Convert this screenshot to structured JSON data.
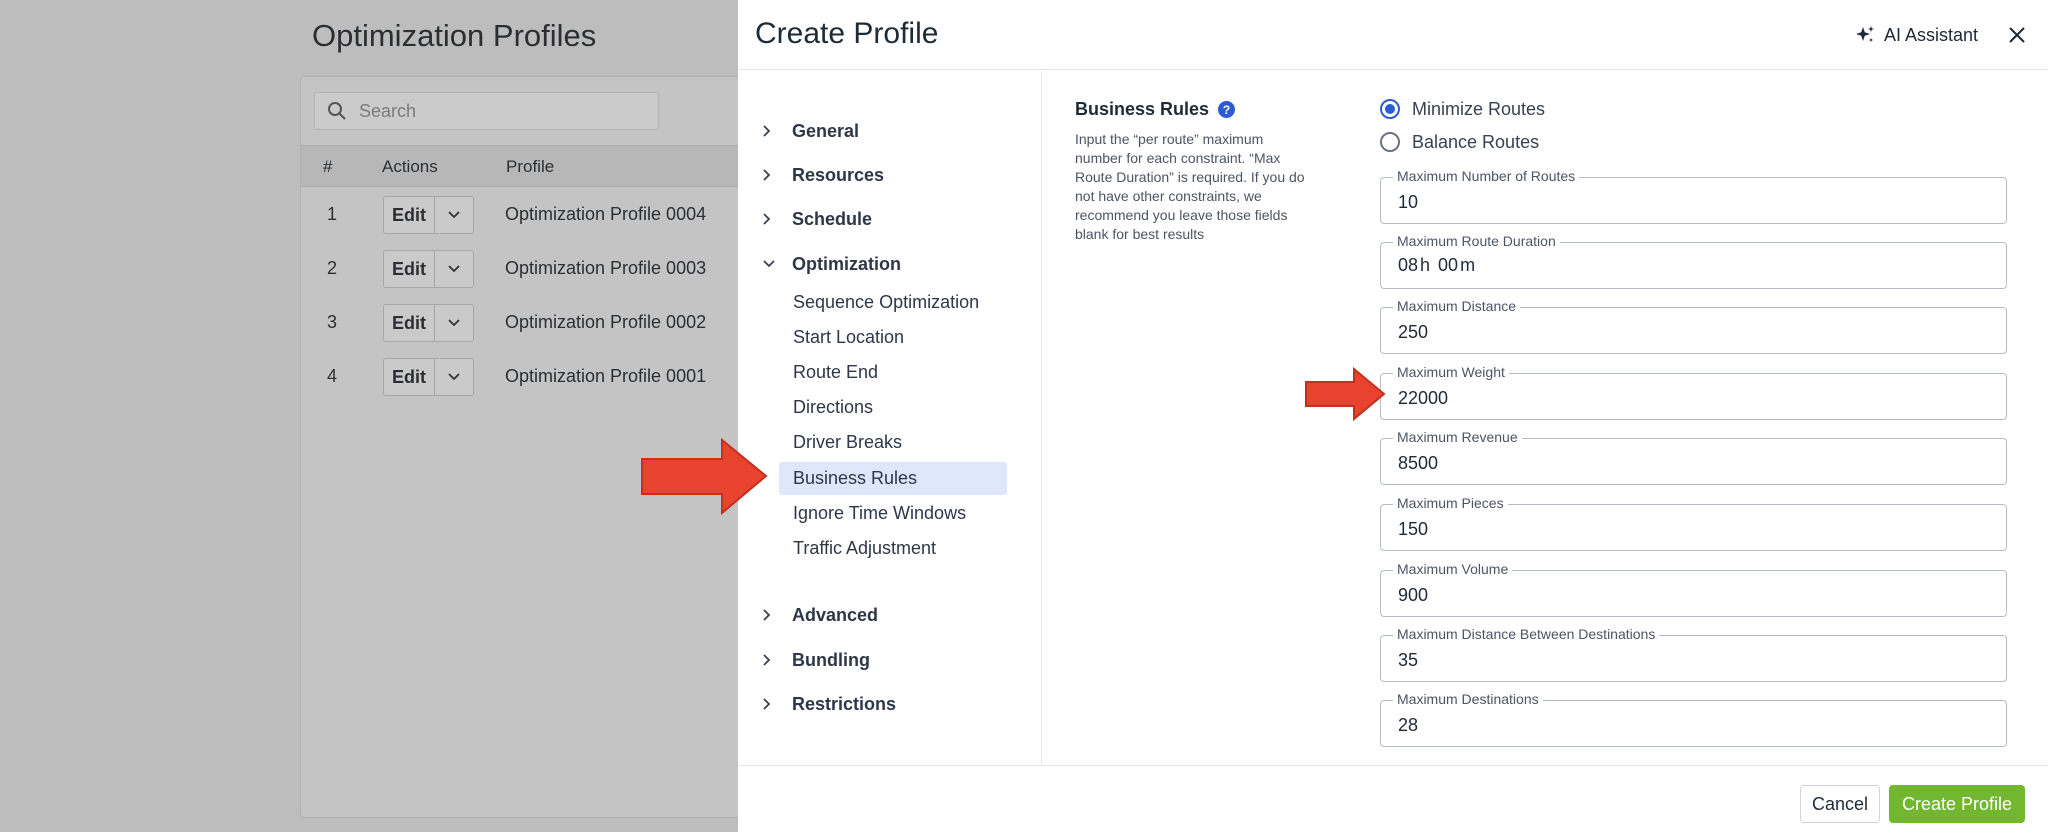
{
  "background": {
    "title": "Optimization Profiles",
    "search_placeholder": "Search",
    "columns": [
      "#",
      "Actions",
      "Profile"
    ],
    "edit_label": "Edit",
    "rows": [
      {
        "num": "1",
        "profile": "Optimization Profile 0004"
      },
      {
        "num": "2",
        "profile": "Optimization Profile 0003"
      },
      {
        "num": "3",
        "profile": "Optimization Profile 0002"
      },
      {
        "num": "4",
        "profile": "Optimization Profile 0001"
      }
    ]
  },
  "drawer": {
    "title": "Create Profile",
    "ai_assistant": "AI Assistant"
  },
  "nav": {
    "general": "General",
    "resources": "Resources",
    "schedule": "Schedule",
    "optimization": "Optimization",
    "optimization_items": [
      "Sequence Optimization",
      "Start Location",
      "Route End",
      "Directions",
      "Driver Breaks",
      "Business Rules",
      "Ignore Time Windows",
      "Traffic Adjustment"
    ],
    "advanced": "Advanced",
    "bundling": "Bundling",
    "restrictions": "Restrictions"
  },
  "business_rules": {
    "title": "Business Rules",
    "description": "Input the “per route” maximum number for each constraint. “Max Route Duration” is required. If you do not have other constraints, we recommend you leave those fields blank for best results",
    "radio_minimize": "Minimize Routes",
    "radio_balance": "Balance Routes",
    "selected_radio": "Minimize Routes",
    "fields": {
      "max_routes": {
        "label": "Maximum Number of Routes",
        "value": "10"
      },
      "max_duration": {
        "label": "Maximum Route Duration",
        "hours": "08",
        "hours_unit": "h",
        "minutes": "00",
        "minutes_unit": "m"
      },
      "max_distance": {
        "label": "Maximum Distance",
        "value": "250"
      },
      "max_weight": {
        "label": "Maximum Weight",
        "value": "22000"
      },
      "max_revenue": {
        "label": "Maximum Revenue",
        "value": "8500"
      },
      "max_pieces": {
        "label": "Maximum Pieces",
        "value": "150"
      },
      "max_volume": {
        "label": "Maximum Volume",
        "value": "900"
      },
      "max_dist_between": {
        "label": "Maximum Distance Between Destinations",
        "value": "35"
      },
      "max_destinations": {
        "label": "Maximum Destinations",
        "value": "28"
      }
    }
  },
  "footer": {
    "cancel": "Cancel",
    "create": "Create Profile"
  },
  "colors": {
    "accent_blue": "#2c5bd3",
    "active_nav_bg": "#dde9fb",
    "create_green": "#72b72f",
    "arrow_red": "#e8432f"
  }
}
